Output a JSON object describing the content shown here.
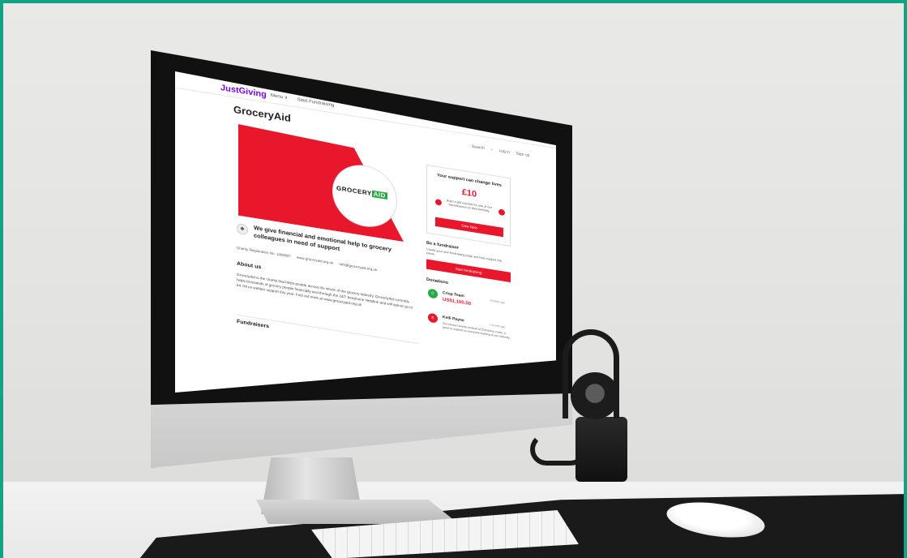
{
  "colors": {
    "frame": "#13a383",
    "brand_purple": "#7a04dd",
    "accent_red": "#e9172b",
    "avatar_green": "#28a745",
    "avatar_red": "#e9172b"
  },
  "site": {
    "brand": "JustGiving",
    "nav": [
      "Menu ∨",
      "Start Fundraising"
    ],
    "header_links": [
      "Search",
      "Log in",
      "Sign up"
    ]
  },
  "charity": {
    "title": "GroceryAid",
    "logo_text": "GROCERY",
    "logo_badge": "AID",
    "tagline": "We give financial and emotional help to grocery colleagues in need of support",
    "registration": "Charity Registration No. 1095897",
    "website": "www.groceryaid.org.uk",
    "email": "info@groceryaid.org.uk",
    "about_heading": "About us",
    "about_text": "GroceryAid is the charity that helps people across the whole of the grocery industry. GroceryAid currently helps thousands of grocery people financially and through the 24/7 freephone Helpline and will spend up to £4.7M on welfare support this year. Find out more at www.groceryaid.org.uk",
    "fundraisers_heading": "Fundraisers"
  },
  "donate_card": {
    "heading": "Your support can change lives",
    "amount": "£10",
    "description": "Buys a gift voucher for one of our beneficiaries on their birthday",
    "button": "Give Now"
  },
  "fundraiser": {
    "heading": "Be a fundraiser",
    "text": "Create your own fundraising page and help support this cause.",
    "button": "Start fundraising"
  },
  "donations": {
    "heading": "Donations",
    "items": [
      {
        "initial": "C",
        "name": "Crisp Team",
        "time": "18 days ago",
        "amount": "US$1,100.00"
      },
      {
        "initial": "K",
        "name": "Kelli Payne",
        "time": "1 month ago",
        "message": "Our chosen charity instead of Christmas cards, a great to support so everyone working in our industry"
      }
    ]
  },
  "device": {
    "logo_icon": "apple-logo-icon"
  }
}
